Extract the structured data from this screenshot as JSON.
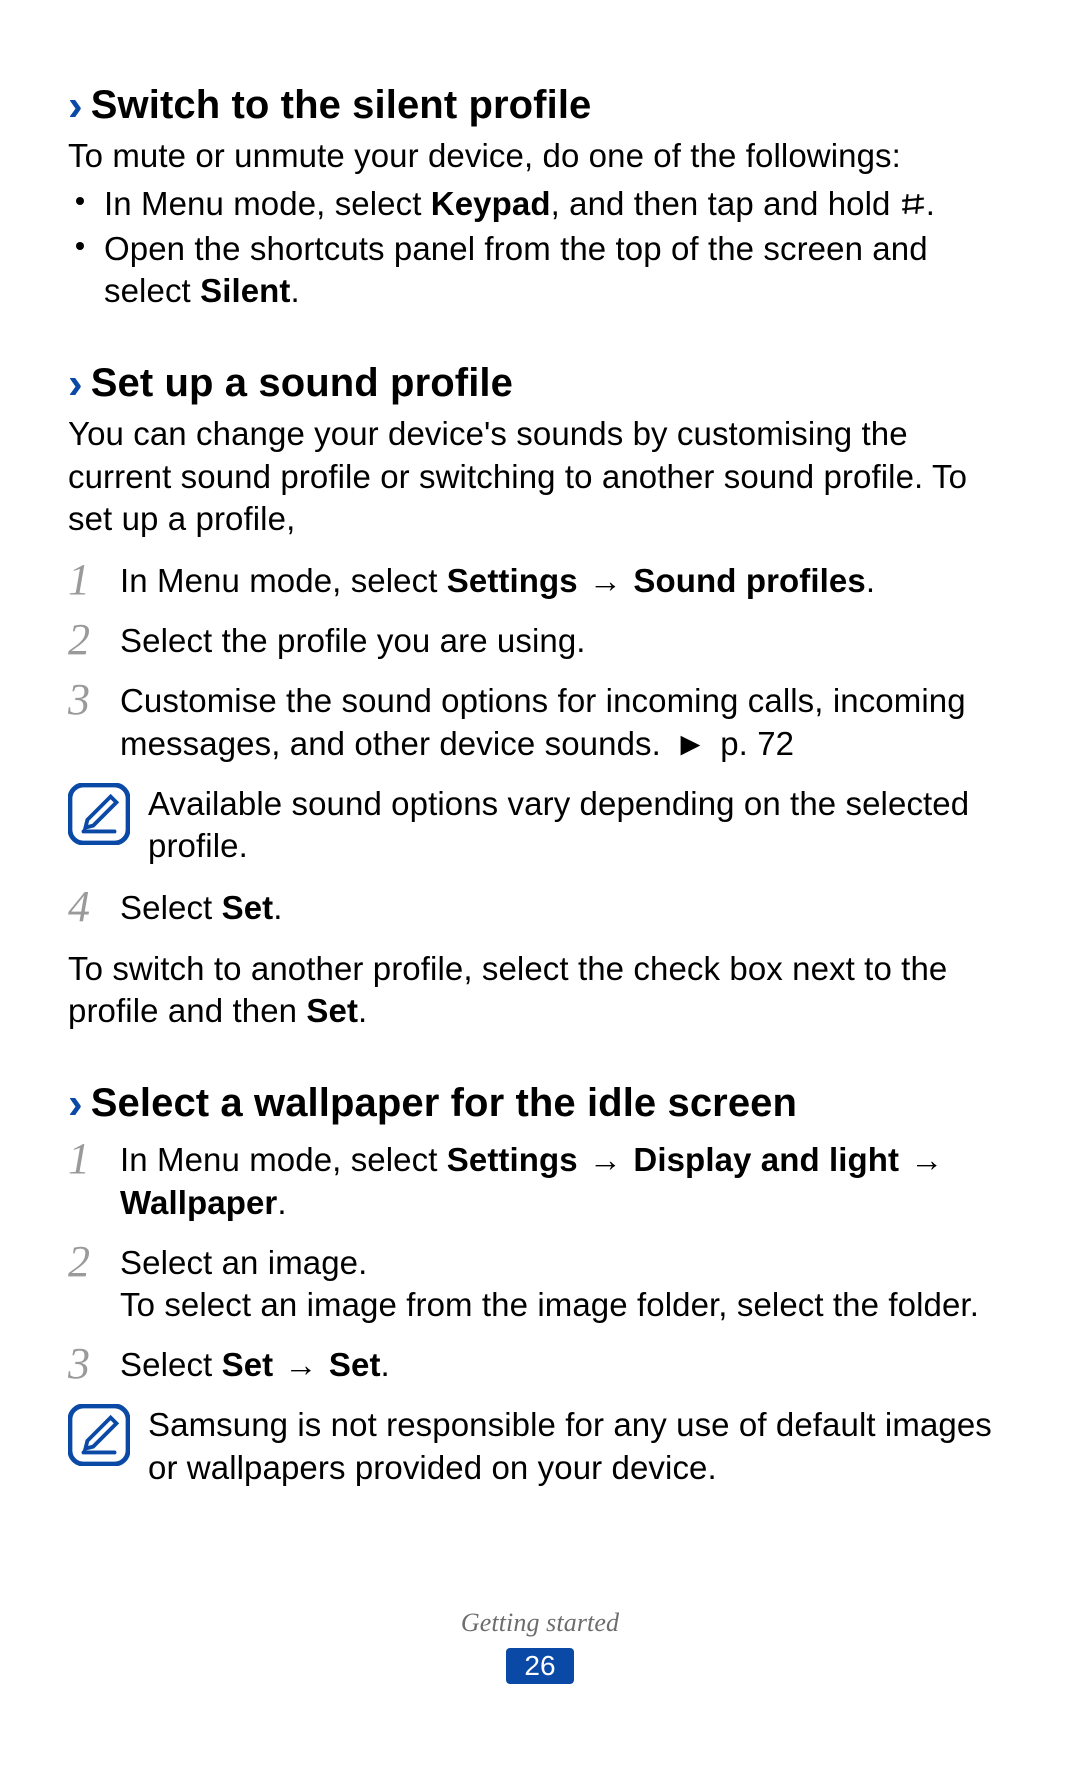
{
  "sections": {
    "silent": {
      "title": "Switch to the silent profile",
      "intro": "To mute or unmute your device, do one of the followings:",
      "bullet1_pre": "In Menu mode, select ",
      "bullet1_bold": "Keypad",
      "bullet1_post": ", and then tap and hold ",
      "bullet1_end": ".",
      "bullet2_pre": "Open the shortcuts panel from the top of the screen and select ",
      "bullet2_bold": "Silent",
      "bullet2_post": "."
    },
    "sound": {
      "title": "Set up a sound profile",
      "intro": "You can change your device's sounds by customising the current sound profile or switching to another sound profile. To set up a profile,",
      "step1_pre": "In Menu mode, select ",
      "step1_bold1": "Settings",
      "arrow": " → ",
      "step1_bold2": "Sound profiles",
      "step1_post": ".",
      "step2": "Select the profile you are using.",
      "step3_pre": "Customise the sound options for incoming calls, incoming messages, and other device sounds. ",
      "tri": "►",
      "step3_post": " p. 72",
      "note": "Available sound options vary depending on the selected profile.",
      "step4_pre": "Select ",
      "step4_bold": "Set",
      "step4_post": ".",
      "outro_pre": "To switch to another profile, select the check box next to the profile and then ",
      "outro_bold": "Set",
      "outro_post": "."
    },
    "wallpaper": {
      "title": "Select a wallpaper for the idle screen",
      "step1_pre": "In Menu mode, select ",
      "step1_bold1": "Settings",
      "step1_bold2": "Display and light",
      "step1_bold3": "Wallpaper",
      "step1_post": ".",
      "step2a": "Select an image.",
      "step2b": "To select an image from the image folder, select the folder.",
      "step3_pre": "Select ",
      "step3_bold1": "Set",
      "step3_bold2": "Set",
      "step3_post": ".",
      "note": "Samsung is not responsible for any use of default images or wallpapers provided on your device."
    }
  },
  "nums": {
    "n1": "1",
    "n2": "2",
    "n3": "3",
    "n4": "4"
  },
  "footer": {
    "label": "Getting started",
    "page": "26"
  }
}
